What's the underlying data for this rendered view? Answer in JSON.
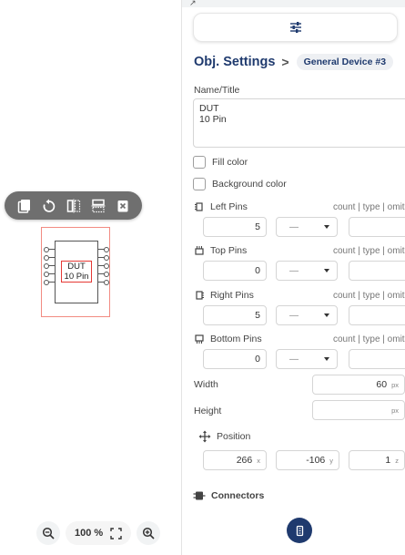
{
  "canvas": {
    "device": {
      "label_line1": "DUT",
      "label_line2": "10 Pin"
    },
    "zoom": {
      "level": "100 %"
    },
    "toolbar_icons": [
      "copy-icon",
      "rotate-icon",
      "flip-horizontal-icon",
      "flip-vertical-icon",
      "delete-icon"
    ]
  },
  "panel": {
    "breadcrumb": {
      "title": "Obj. Settings",
      "separator": ">",
      "chip": "General Device #3"
    },
    "name": {
      "label": "Name/Title",
      "value": "DUT\n10 Pin"
    },
    "fill_color": {
      "label": "Fill color"
    },
    "background_color": {
      "label": "Background color"
    },
    "pins": [
      {
        "label": "Left Pins",
        "hint": "count | type | omit",
        "count": "5",
        "type": "—"
      },
      {
        "label": "Top Pins",
        "hint": "count | type | omit",
        "count": "0",
        "type": "—"
      },
      {
        "label": "Right Pins",
        "hint": "count | type | omit",
        "count": "5",
        "type": "—"
      },
      {
        "label": "Bottom Pins",
        "hint": "count | type | omit",
        "count": "0",
        "type": "—"
      }
    ],
    "width": {
      "label": "Width",
      "value": "60",
      "unit": "px"
    },
    "height": {
      "label": "Height",
      "value": "",
      "unit": "px"
    },
    "position": {
      "label": "Position",
      "x": {
        "value": "266",
        "unit": "x"
      },
      "y": {
        "value": "-106",
        "unit": "y"
      },
      "z": {
        "value": "1",
        "unit": "z"
      }
    },
    "connectors": {
      "label": "Connectors"
    }
  },
  "colors": {
    "accent": "#1f3a6e",
    "selection": "#f28b82",
    "toolbar": "#6f6f6f"
  }
}
